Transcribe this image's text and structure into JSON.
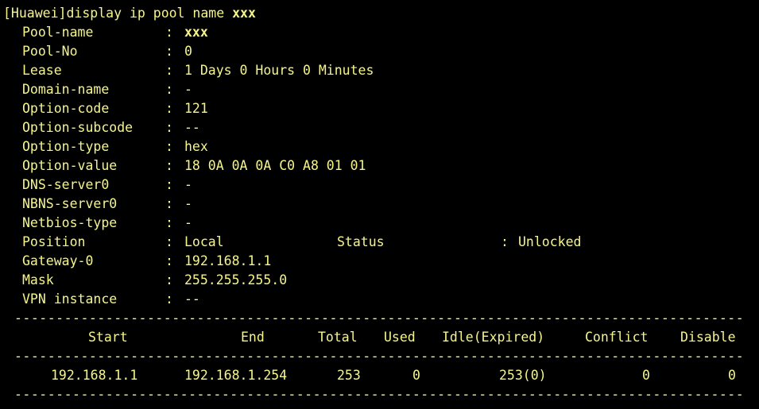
{
  "terminal": {
    "prompt": "[Huawei]",
    "command": "display ip pool name ",
    "command_arg": "xxx",
    "fields": [
      {
        "key": "Pool-name",
        "value": "xxx"
      },
      {
        "key": "Pool-No",
        "value": "0"
      },
      {
        "key": "Lease",
        "value": "1 Days 0 Hours 0 Minutes"
      },
      {
        "key": "Domain-name",
        "value": "-"
      },
      {
        "key": "Option-code",
        "value": "121"
      },
      {
        "key": "Option-subcode",
        "value": "--"
      },
      {
        "key": "Option-type",
        "value": "hex"
      },
      {
        "key": "Option-value",
        "value": "18 0A 0A 0A C0 A8 01 01"
      },
      {
        "key": "DNS-server0",
        "value": "-"
      },
      {
        "key": "NBNS-server0",
        "value": "-"
      },
      {
        "key": "Netbios-type",
        "value": "-"
      },
      {
        "key": "Position",
        "value": "Local",
        "key2": "Status",
        "value2": "Unlocked"
      },
      {
        "key": "Gateway-0",
        "value": "192.168.1.1"
      },
      {
        "key": "Mask",
        "value": "255.255.255.0"
      },
      {
        "key": "VPN instance",
        "value": "--"
      }
    ],
    "colon": ":",
    "separator": "-------------------------------------------------------------------------------------------",
    "table": {
      "headers": {
        "start": "Start",
        "end": "End",
        "total": "Total",
        "used": "Used",
        "idle": "Idle(Expired)",
        "conflict": "Conflict",
        "disable": "Disable"
      },
      "row": {
        "start": "192.168.1.1",
        "end": "192.168.1.254",
        "total": "253",
        "used": "0",
        "idle": "253(0)",
        "conflict": "0",
        "disable": "0"
      }
    },
    "colors": {
      "background": "#000000",
      "text": "#f5f58a"
    }
  }
}
